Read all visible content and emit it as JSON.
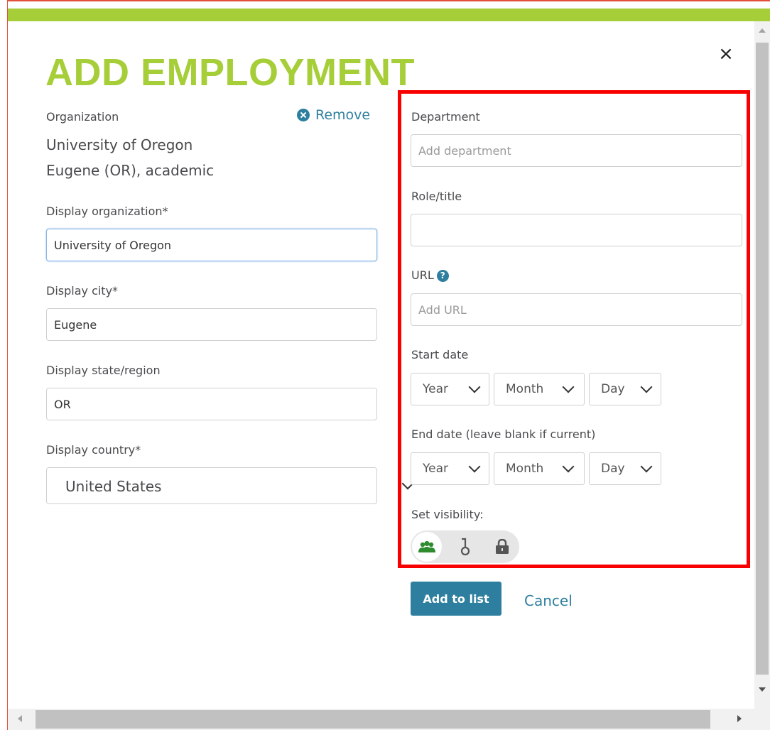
{
  "dialog": {
    "title": "ADD EMPLOYMENT",
    "close_label": "×"
  },
  "left": {
    "organization_label": "Organization",
    "remove_label": "Remove",
    "org_name": "University of Oregon",
    "org_details": "Eugene (OR), academic",
    "display_org_label": "Display organization*",
    "display_org_value": "University of Oregon",
    "display_city_label": "Display city*",
    "display_city_value": "Eugene",
    "display_state_label": "Display state/region",
    "display_state_value": "OR",
    "display_country_label": "Display country*",
    "display_country_value": "United States"
  },
  "right": {
    "department_label": "Department",
    "department_placeholder": "Add department",
    "role_label": "Role/title",
    "role_value": "",
    "url_label": "URL",
    "url_help": "?",
    "url_placeholder": "Add URL",
    "start_date_label": "Start date",
    "end_date_label": "End date (leave blank if current)",
    "year_label": "Year",
    "month_label": "Month",
    "day_label": "Day",
    "visibility_label": "Set visibility:",
    "visibility_options": [
      "everyone-icon",
      "key-icon",
      "lock-icon"
    ],
    "visibility_selected": "everyone"
  },
  "actions": {
    "add_label": "Add to list",
    "cancel_label": "Cancel"
  },
  "colors": {
    "brand_green": "#a6ce39",
    "link_blue": "#2e7f9f",
    "highlight_red": "#f80000"
  }
}
